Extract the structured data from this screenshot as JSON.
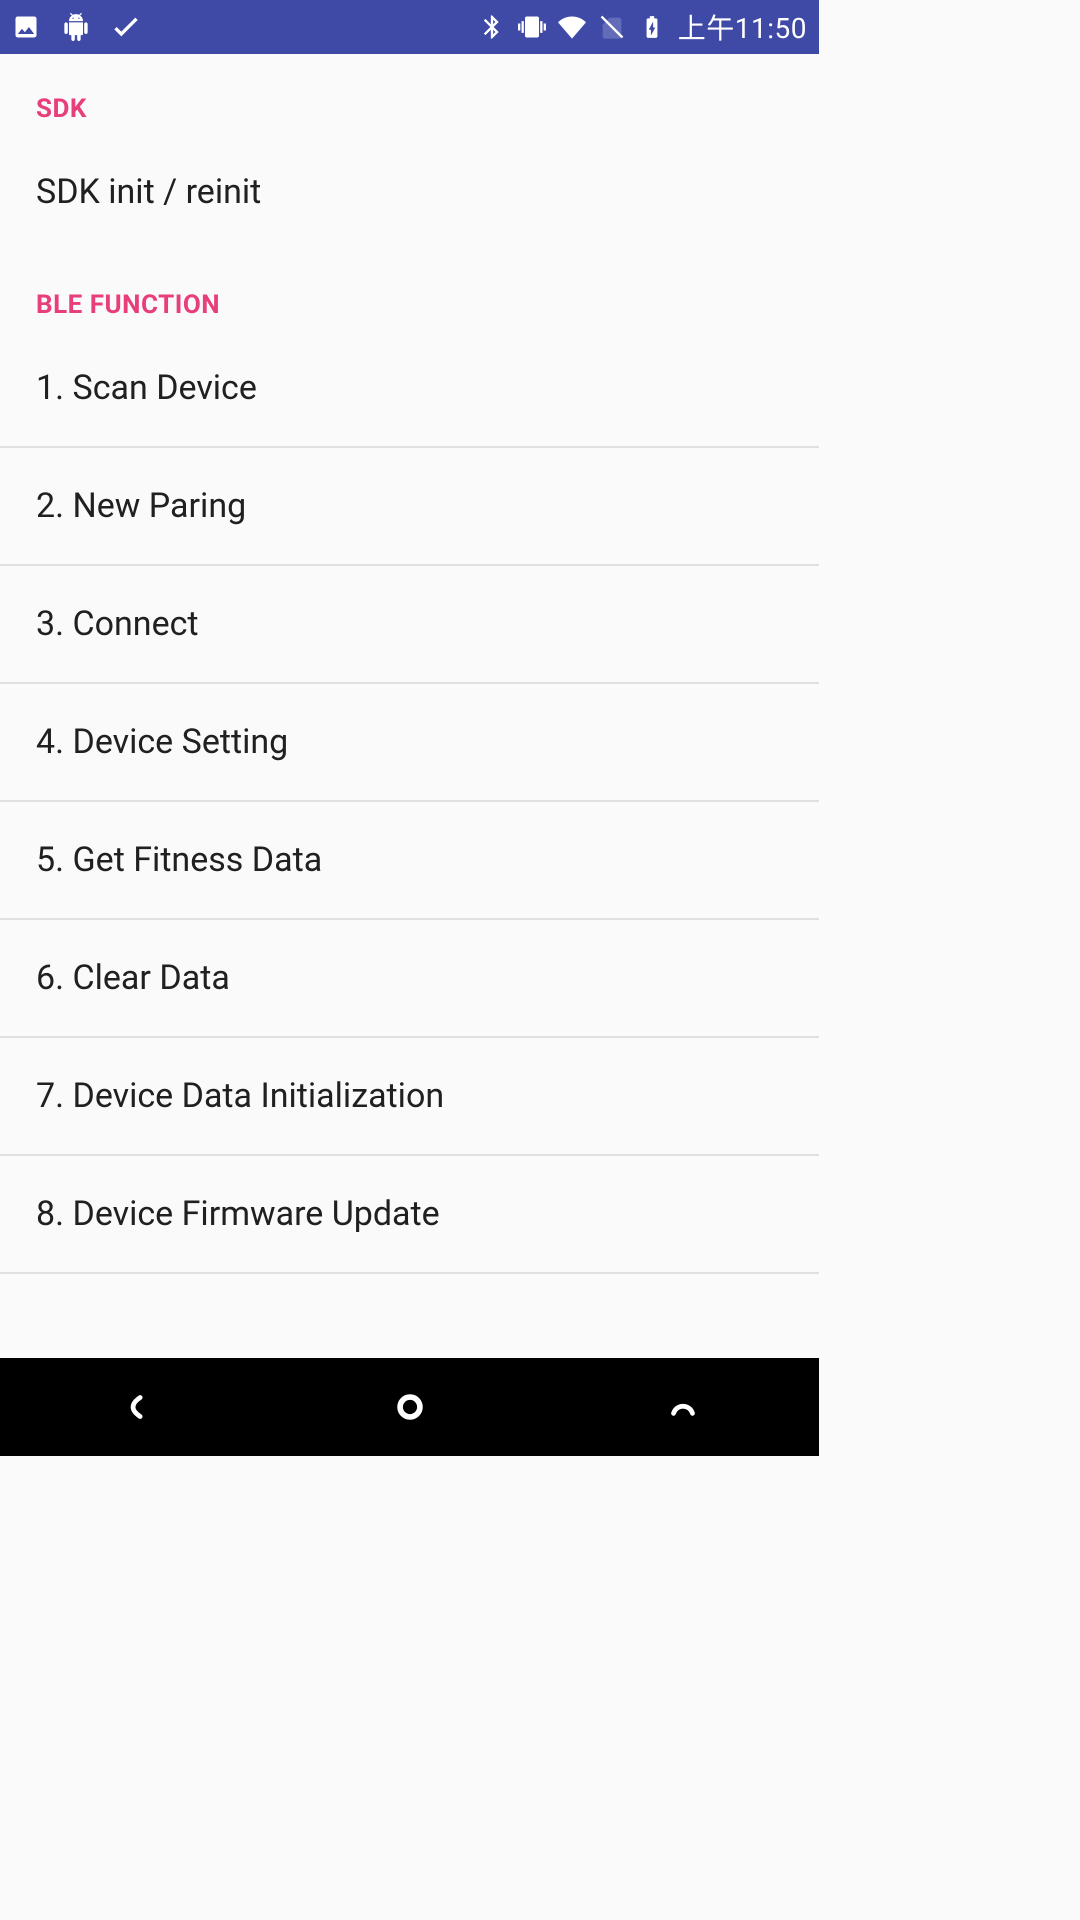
{
  "status_bar": {
    "time": "上午11:50"
  },
  "sections": {
    "sdk": {
      "header": "SDK",
      "items": [
        "SDK init / reinit"
      ]
    },
    "ble": {
      "header": "BLE FUNCTION",
      "items": [
        "1. Scan Device",
        "2. New Paring",
        "3. Connect",
        "4. Device Setting",
        "5. Get Fitness Data",
        "6. Clear Data",
        "7. Device Data Initialization",
        "8. Device Firmware Update"
      ]
    }
  }
}
